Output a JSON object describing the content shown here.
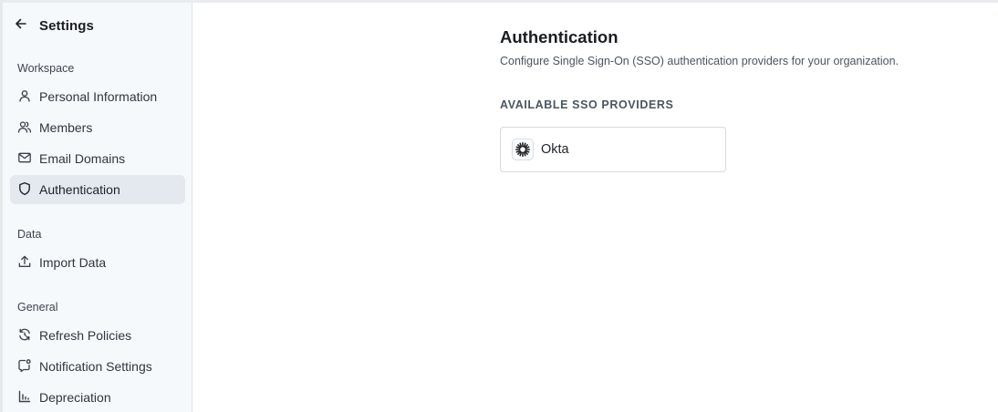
{
  "sidebar": {
    "title": "Settings",
    "sections": [
      {
        "label": "Workspace",
        "items": [
          {
            "label": "Personal Information",
            "icon": "user-icon"
          },
          {
            "label": "Members",
            "icon": "users-icon"
          },
          {
            "label": "Email Domains",
            "icon": "mail-icon"
          },
          {
            "label": "Authentication",
            "icon": "shield-icon",
            "active": true
          }
        ]
      },
      {
        "label": "Data",
        "items": [
          {
            "label": "Import Data",
            "icon": "upload-icon"
          }
        ]
      },
      {
        "label": "General",
        "items": [
          {
            "label": "Refresh Policies",
            "icon": "refresh-icon"
          },
          {
            "label": "Notification Settings",
            "icon": "notification-icon"
          },
          {
            "label": "Depreciation",
            "icon": "chart-icon"
          }
        ]
      }
    ]
  },
  "main": {
    "title": "Authentication",
    "description": "Configure Single Sign-On (SSO) authentication providers for your organization.",
    "providers_label": "AVAILABLE SSO PROVIDERS",
    "providers": [
      {
        "name": "Okta",
        "icon": "okta-logo-icon"
      }
    ]
  },
  "colors": {
    "sidebar_bg": "#f6f9fc",
    "active_item_bg": "#e4e9ef",
    "border": "#d6dbe1"
  }
}
